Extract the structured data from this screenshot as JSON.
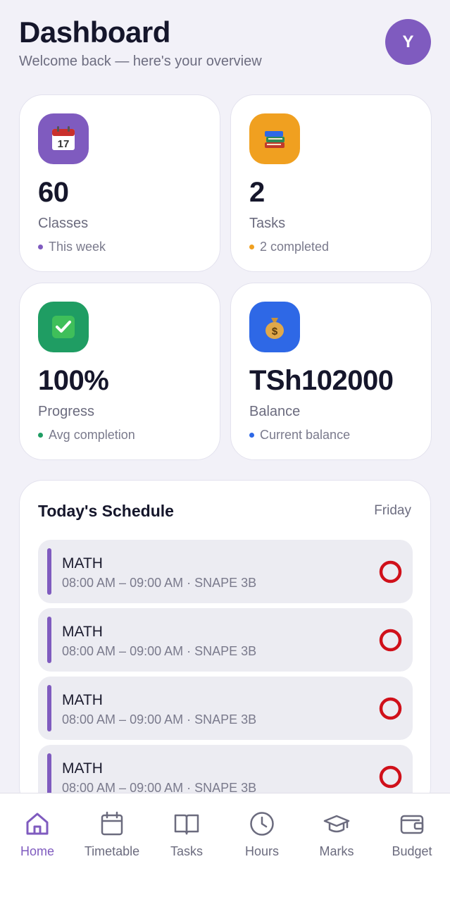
{
  "header": {
    "title": "Dashboard",
    "subtitle": "Welcome back — here's your overview",
    "avatar_letter": "Y"
  },
  "stats": [
    {
      "icon": "calendar-icon",
      "icon_bg": "#7f5bbf",
      "value": "60",
      "label": "Classes",
      "sub": "This week",
      "dot_color": "#7f5bbf"
    },
    {
      "icon": "books-icon",
      "icon_bg": "#f0a020",
      "value": "2",
      "label": "Tasks",
      "sub": "2 completed",
      "dot_color": "#f0a020"
    },
    {
      "icon": "check-icon",
      "icon_bg": "#1f9d63",
      "value": "100%",
      "label": "Progress",
      "sub": "Avg completion",
      "dot_color": "#1f9d63"
    },
    {
      "icon": "money-bag-icon",
      "icon_bg": "#2e68e6",
      "value": "TSh102000",
      "label": "Balance",
      "sub": "Current balance",
      "dot_color": "#2e68e6"
    }
  ],
  "schedule": {
    "title": "Today's Schedule",
    "day": "Friday",
    "items": [
      {
        "subject": "MATH",
        "time": "08:00 AM – 09:00 AM · SNAPE 3B"
      },
      {
        "subject": "MATH",
        "time": "08:00 AM – 09:00 AM · SNAPE 3B"
      },
      {
        "subject": "MATH",
        "time": "08:00 AM – 09:00 AM · SNAPE 3B"
      },
      {
        "subject": "MATH",
        "time": "08:00 AM – 09:00 AM · SNAPE 3B"
      }
    ]
  },
  "nav": [
    {
      "label": "Home",
      "icon": "home-icon",
      "active": true
    },
    {
      "label": "Timetable",
      "icon": "calendar-icon",
      "active": false
    },
    {
      "label": "Tasks",
      "icon": "book-icon",
      "active": false
    },
    {
      "label": "Hours",
      "icon": "clock-icon",
      "active": false
    },
    {
      "label": "Marks",
      "icon": "graduation-cap-icon",
      "active": false
    },
    {
      "label": "Budget",
      "icon": "wallet-icon",
      "active": false
    }
  ],
  "colors": {
    "accent": "#7f5bbf",
    "status_ring": "#d0101a"
  }
}
